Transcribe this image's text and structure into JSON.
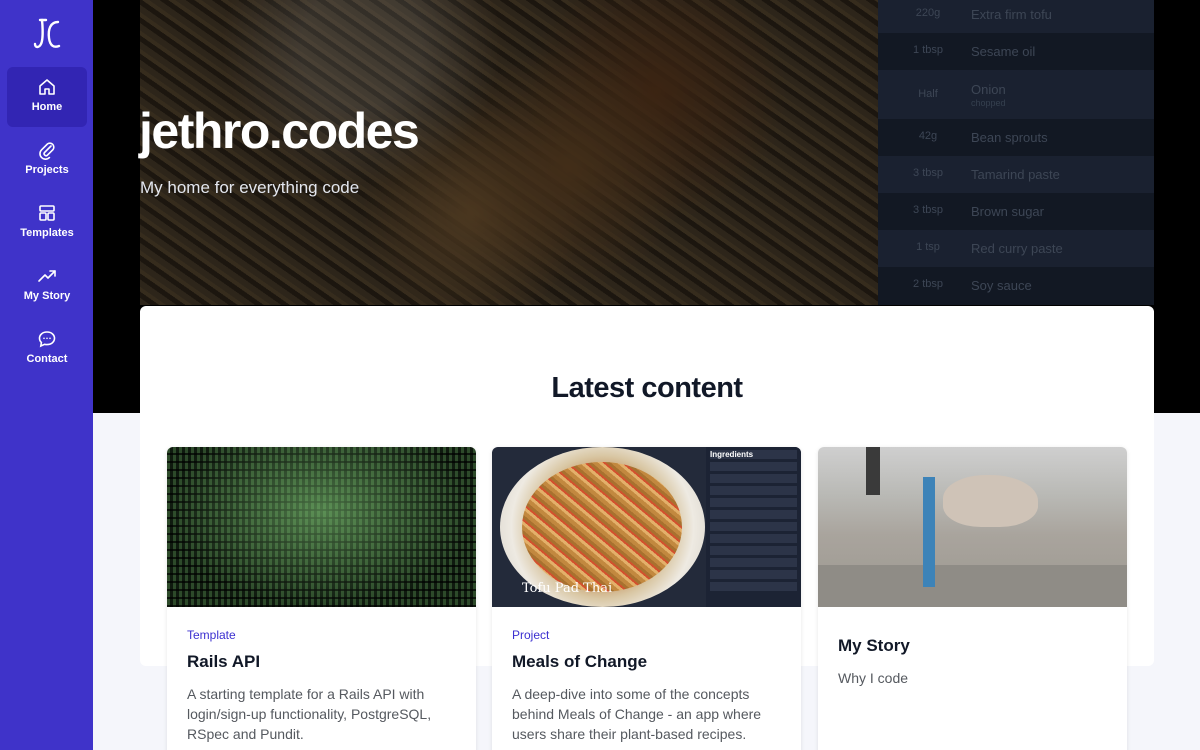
{
  "brand": {
    "logo_icon": "jc-logo-icon"
  },
  "sidebar": {
    "items": [
      {
        "label": "Home",
        "icon": "home-icon",
        "active": true
      },
      {
        "label": "Projects",
        "icon": "paperclip-icon",
        "active": false
      },
      {
        "label": "Templates",
        "icon": "layout-icon",
        "active": false
      },
      {
        "label": "My Story",
        "icon": "trending-up-icon",
        "active": false
      },
      {
        "label": "Contact",
        "icon": "chat-bubble-icon",
        "active": false
      }
    ]
  },
  "hero": {
    "title": "jethro.codes",
    "subtitle": "My home for everything code",
    "ingredients": [
      {
        "qty": "220g",
        "name": "Extra firm tofu",
        "note": ""
      },
      {
        "qty": "1 tbsp",
        "name": "Sesame oil",
        "note": ""
      },
      {
        "qty": "Half",
        "name": "Onion",
        "note": "chopped"
      },
      {
        "qty": "42g",
        "name": "Bean sprouts",
        "note": ""
      },
      {
        "qty": "3 tbsp",
        "name": "Tamarind paste",
        "note": ""
      },
      {
        "qty": "3 tbsp",
        "name": "Brown sugar",
        "note": ""
      },
      {
        "qty": "1 tsp",
        "name": "Red curry paste",
        "note": ""
      },
      {
        "qty": "2 tbsp",
        "name": "Soy sauce",
        "note": ""
      }
    ]
  },
  "latest": {
    "heading": "Latest content",
    "cards": [
      {
        "kicker": "Template",
        "title": "Rails API",
        "description": "A starting template for a Rails API with login/sign-up functionality, PostgreSQL, RSpec and Pundit."
      },
      {
        "kicker": "Project",
        "title": "Meals of Change",
        "description": "A deep-dive into some of the concepts behind Meals of Change - an app where users share their plant-based recipes.",
        "image_caption": "Tofu Pad Thai",
        "image_header": "Ingredients"
      },
      {
        "kicker": "",
        "title": "My Story",
        "description": "Why I code"
      }
    ]
  },
  "colors": {
    "sidebar": "#3f33c9",
    "accent": "#3b2fd0",
    "hero_bg": "#000000"
  }
}
